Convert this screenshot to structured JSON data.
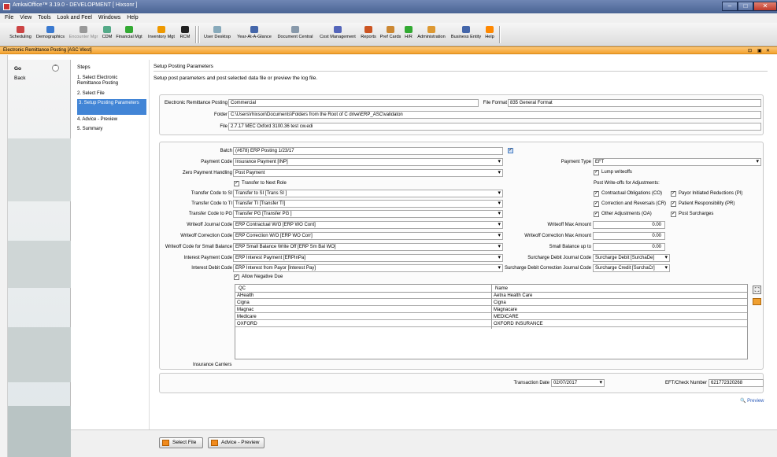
{
  "window": {
    "title": "AmkaiOffice™ 3.19.0 - DEVELOPMENT [ Hixsonr ]",
    "min": "–",
    "max": "□",
    "close": "✕"
  },
  "menu": [
    "File",
    "View",
    "Tools",
    "Look and Feel",
    "Windows",
    "Help"
  ],
  "toolbar_left": [
    "Scheduling",
    "Demographics",
    "Encounter Mgr",
    "CDM",
    "Financial Mgt",
    "Inventory Mgt",
    "RCM"
  ],
  "toolbar_right": [
    "User Desktop",
    "Year-At-A-Glance",
    "Document Central",
    "Cost Management",
    "Reports",
    "Pref Cards",
    "H/R",
    "Administration",
    "Business Entity",
    "Help"
  ],
  "module": {
    "title": "Electronic Remittance Posting [ASC West]",
    "controls": [
      "⊡",
      "▣",
      "✕"
    ]
  },
  "go_panel": {
    "go": "Go",
    "back": "Back",
    "collapse": "⌃"
  },
  "steps": {
    "header": "Steps",
    "items": [
      "1. Select Electronic Remittance Posting",
      "2. Select File",
      "3. Setup Posting Parameters",
      "4. Advice - Preview",
      "5. Summary"
    ]
  },
  "page": {
    "title": "Setup Posting Parameters",
    "subtitle": "Setup post parameters and post selected data file or preview the log file."
  },
  "file_info": {
    "erp_label": "Electronic Remittance Posting",
    "erp_value": "Commercial",
    "format_label": "File Format",
    "format_value": "835 General Format",
    "folder_label": "Folder",
    "folder_value": "C:\\Users\\rhixson\\Documents\\Folders from the Root of C drive\\ERP_ASC\\validaton",
    "file_label": "File",
    "file_value": "2.7.17 MEC Oxford 3100.36 test cw.edi"
  },
  "params": {
    "batch_label": "Batch",
    "batch_value": "(#678) ERP Posting 1/23/17",
    "payment_code_label": "Payment Code",
    "payment_code_value": "Insurance Payment  [INP]",
    "zero_payment_label": "Zero Payment Handling",
    "zero_payment_value": "Post Payment",
    "transfer_next_role": "Transfer to Next Role",
    "si_label": "Transfer Code to SI",
    "si_value": "Transfer to SI   [Trans SI ]",
    "ti_label": "Transfer Code to TI",
    "ti_value": "Transfer TI  [Transfer TI]",
    "pg_label": "Transfer Code to PG",
    "pg_value": "Transfer PG  [Transfer PG ]",
    "wo_journal_label": "Writeoff Journal Code",
    "wo_journal_value": "ERP Contractual W/O  [ERP WO Cont]",
    "wo_corr_label": "Writeoff Correction Code",
    "wo_corr_value": "ERP Correction W/O  [ERP WO Corr]",
    "wo_small_label": "Writeoff Code for Small Balance",
    "wo_small_value": "ERP Small Balance Write Off  [ERP Sm Bal WO]",
    "int_pay_label": "Interest Payment Code",
    "int_pay_value": "ERP Interest Payment  [ERPInPa]",
    "int_debit_label": "Interest Debit Code",
    "int_debit_value": "ERP Interest from Payor  [Interest Pay]",
    "allow_negative": "Allow Negative Due",
    "payment_type_label": "Payment Type",
    "payment_type_value": "EFT",
    "lump_writeoffs": "Lump writeoffs",
    "post_writeoffs_label": "Post Write-offs for Adjustments:",
    "adj_co": "Contractual Obligations (CO)",
    "adj_pi": "Payor Initiated Reductions (PI)",
    "adj_cr": "Correction and Reversals (CR)",
    "adj_pr": "Patient Responsibility (PR)",
    "adj_oa": "Other Adjustments (OA)",
    "post_surcharges": "Post Surcharges",
    "wo_max_label": "Writeoff Max Amount",
    "wo_max_value": "0.00",
    "wo_corr_max_label": "Writeoff Correction Max Amount",
    "wo_corr_max_value": "0.00",
    "small_bal_label": "Small Balance up to",
    "small_bal_value": "0.00",
    "surch_debit_label": "Surcharge Debit Journal Code",
    "surch_debit_value": "Surcharge Debit  [SurchaDe]",
    "surch_corr_label": "Surcharge Debit Correction Journal Code",
    "surch_corr_value": "Surcharge Credit  [SurchaCr]"
  },
  "carriers": {
    "label": "Insurance Carriers",
    "columns": [
      "QC",
      "Name"
    ],
    "rows": [
      [
        "AHealth",
        "Aetna Health Care"
      ],
      [
        "Cigna",
        "Cigna"
      ],
      [
        "Magnac",
        "Magnacare"
      ],
      [
        "Medicare",
        "MEDICARE"
      ],
      [
        "OXFORD",
        "OXFORD INSURANCE"
      ]
    ]
  },
  "transaction": {
    "date_label": "Transaction Date",
    "date_value": "02/07/2017",
    "eft_label": "EFT/Check Number",
    "eft_value": "621772320268"
  },
  "preview_link": "Preview",
  "buttons": {
    "select_file": "Select File",
    "advice_preview": "Advice - Preview"
  },
  "colors": {
    "active_step": "#4285d6",
    "module_bar": "#f4a22e",
    "titlebar": "#4a6494"
  }
}
